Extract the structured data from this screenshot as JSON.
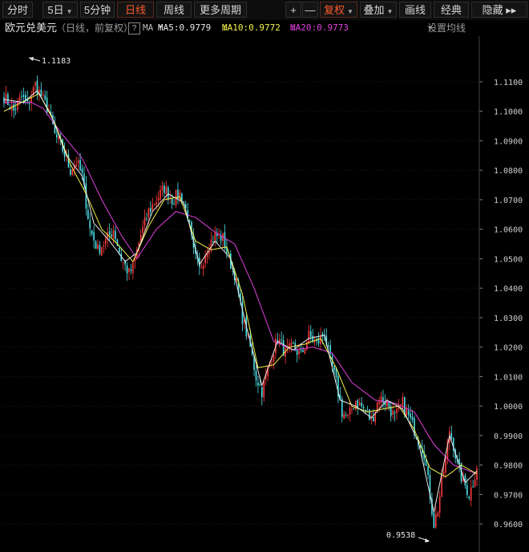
{
  "toolbar": {
    "tabs": [
      "分时",
      "5日",
      "5分钟",
      "日线",
      "周线",
      "更多周期"
    ],
    "plus": "+",
    "minus": "—",
    "fuquan": "复权",
    "diejia": "叠加",
    "huaxian": "画线",
    "jingdian": "经典",
    "yincang": "隐藏",
    "more": "▸▸"
  },
  "info": {
    "name": "欧元兑美元",
    "sub": "（日线，前复权）",
    "help": "?",
    "ma_label": "MA",
    "ma5": "MA5:0.9779",
    "ma5_arrow": "↑",
    "ma10": "MA10:0.9772",
    "ma10_arrow": "↓",
    "ma20": "MA20:0.9773",
    "ma20_arrow": "↓",
    "set_ma": "设置均线"
  },
  "colors": {
    "up": "#ff3c3c",
    "down": "#4fe3ea",
    "ma5": "#e8e8e8",
    "ma10": "#f2f24a",
    "ma20": "#e040e0",
    "accent": "#ff5a2a"
  },
  "chart_data": {
    "type": "candlestick",
    "y_ticks": [
      "1.1100",
      "1.1000",
      "1.0900",
      "1.0800",
      "1.0700",
      "1.0600",
      "1.0500",
      "1.0400",
      "1.0300",
      "1.0200",
      "1.0100",
      "1.0000",
      "0.9900",
      "0.9800",
      "0.9700",
      "0.9600"
    ],
    "ylim": [
      0.9505,
      1.1255
    ],
    "max_label": "1.1183",
    "min_label": "0.9538",
    "close_anchors": [
      [
        0,
        1.105
      ],
      [
        5,
        1.1
      ],
      [
        9,
        1.105
      ],
      [
        12,
        1.102
      ],
      [
        16,
        1.109
      ],
      [
        20,
        1.104
      ],
      [
        23,
        1.1
      ],
      [
        26,
        1.092
      ],
      [
        30,
        1.087
      ],
      [
        34,
        1.08
      ],
      [
        37,
        1.083
      ],
      [
        40,
        1.078
      ],
      [
        44,
        1.06
      ],
      [
        48,
        1.053
      ],
      [
        52,
        1.056
      ],
      [
        56,
        1.06
      ],
      [
        60,
        1.05
      ],
      [
        64,
        1.045
      ],
      [
        66,
        1.047
      ],
      [
        70,
        1.058
      ],
      [
        74,
        1.066
      ],
      [
        78,
        1.07
      ],
      [
        82,
        1.074
      ],
      [
        86,
        1.07
      ],
      [
        90,
        1.072
      ],
      [
        94,
        1.065
      ],
      [
        97,
        1.052
      ],
      [
        100,
        1.046
      ],
      [
        104,
        1.054
      ],
      [
        108,
        1.058
      ],
      [
        112,
        1.057
      ],
      [
        115,
        1.05
      ],
      [
        118,
        1.045
      ],
      [
        122,
        1.03
      ],
      [
        126,
        1.02
      ],
      [
        129,
        1.01
      ],
      [
        132,
        1.005
      ],
      [
        136,
        1.015
      ],
      [
        140,
        1.023
      ],
      [
        144,
        1.018
      ],
      [
        148,
        1.02
      ],
      [
        152,
        1.017
      ],
      [
        156,
        1.024
      ],
      [
        160,
        1.021
      ],
      [
        164,
        1.025
      ],
      [
        166,
        1.018
      ],
      [
        170,
        1.008
      ],
      [
        173,
        0.998
      ],
      [
        176,
        0.996
      ],
      [
        180,
        1.002
      ],
      [
        184,
        0.999
      ],
      [
        188,
        0.995
      ],
      [
        192,
        1.003
      ],
      [
        196,
        1.001
      ],
      [
        200,
        0.996
      ],
      [
        204,
        1.001
      ],
      [
        208,
        0.995
      ],
      [
        212,
        0.989
      ],
      [
        215,
        0.984
      ],
      [
        218,
        0.97
      ],
      [
        220,
        0.96
      ],
      [
        222,
        0.965
      ],
      [
        224,
        0.974
      ],
      [
        226,
        0.982
      ],
      [
        228,
        0.992
      ],
      [
        230,
        0.987
      ],
      [
        232,
        0.98
      ],
      [
        234,
        0.976
      ],
      [
        236,
        0.973
      ],
      [
        238,
        0.97
      ],
      [
        240,
        0.974
      ],
      [
        242,
        0.98
      ]
    ],
    "ma5_anchors": [
      [
        0,
        1.104
      ],
      [
        10,
        1.103
      ],
      [
        17,
        1.107
      ],
      [
        24,
        1.099
      ],
      [
        32,
        1.085
      ],
      [
        40,
        1.078
      ],
      [
        46,
        1.062
      ],
      [
        54,
        1.056
      ],
      [
        62,
        1.049
      ],
      [
        68,
        1.052
      ],
      [
        76,
        1.066
      ],
      [
        84,
        1.072
      ],
      [
        92,
        1.069
      ],
      [
        100,
        1.048
      ],
      [
        108,
        1.056
      ],
      [
        116,
        1.05
      ],
      [
        124,
        1.027
      ],
      [
        132,
        1.007
      ],
      [
        140,
        1.022
      ],
      [
        148,
        1.019
      ],
      [
        156,
        1.023
      ],
      [
        164,
        1.024
      ],
      [
        172,
        1.002
      ],
      [
        180,
        1.0
      ],
      [
        188,
        0.996
      ],
      [
        196,
        1.002
      ],
      [
        204,
        0.999
      ],
      [
        212,
        0.988
      ],
      [
        220,
        0.964
      ],
      [
        228,
        0.99
      ],
      [
        236,
        0.974
      ],
      [
        242,
        0.978
      ]
    ],
    "ma10_anchors": [
      [
        0,
        1.1
      ],
      [
        12,
        1.104
      ],
      [
        18,
        1.106
      ],
      [
        26,
        1.096
      ],
      [
        34,
        1.082
      ],
      [
        42,
        1.072
      ],
      [
        50,
        1.06
      ],
      [
        58,
        1.055
      ],
      [
        66,
        1.049
      ],
      [
        74,
        1.061
      ],
      [
        82,
        1.07
      ],
      [
        90,
        1.071
      ],
      [
        98,
        1.056
      ],
      [
        106,
        1.053
      ],
      [
        114,
        1.054
      ],
      [
        122,
        1.038
      ],
      [
        130,
        1.013
      ],
      [
        138,
        1.014
      ],
      [
        146,
        1.02
      ],
      [
        154,
        1.021
      ],
      [
        162,
        1.023
      ],
      [
        170,
        1.013
      ],
      [
        178,
        1.0
      ],
      [
        186,
        0.998
      ],
      [
        194,
        0.999
      ],
      [
        202,
        1.0
      ],
      [
        210,
        0.992
      ],
      [
        218,
        0.979
      ],
      [
        226,
        0.976
      ],
      [
        234,
        0.98
      ],
      [
        242,
        0.977
      ]
    ],
    "ma20_anchors": [
      [
        0,
        1.103
      ],
      [
        14,
        1.103
      ],
      [
        20,
        1.101
      ],
      [
        30,
        1.092
      ],
      [
        40,
        1.084
      ],
      [
        50,
        1.07
      ],
      [
        60,
        1.058
      ],
      [
        68,
        1.05
      ],
      [
        78,
        1.06
      ],
      [
        88,
        1.066
      ],
      [
        98,
        1.064
      ],
      [
        108,
        1.059
      ],
      [
        118,
        1.055
      ],
      [
        128,
        1.04
      ],
      [
        138,
        1.022
      ],
      [
        148,
        1.019
      ],
      [
        158,
        1.02
      ],
      [
        168,
        1.018
      ],
      [
        178,
        1.008
      ],
      [
        190,
        1.002
      ],
      [
        200,
        1.001
      ],
      [
        210,
        0.998
      ],
      [
        220,
        0.987
      ],
      [
        230,
        0.98
      ],
      [
        242,
        0.977
      ]
    ]
  }
}
